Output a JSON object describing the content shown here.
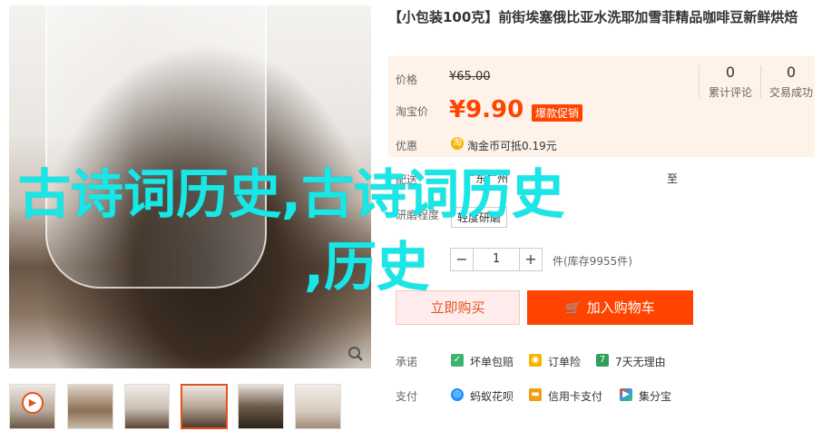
{
  "product": {
    "title": "【小包装100克】前街埃塞俄比亚水洗耶加雪菲精品咖啡豆新鲜烘焙"
  },
  "price": {
    "original_label": "价格",
    "original_value": "¥65.00",
    "promo_label": "淘宝价",
    "promo_value": "¥9.90",
    "promo_badge": "爆款促销"
  },
  "stats": [
    {
      "count": "0",
      "label": "累计评论"
    },
    {
      "count": "0",
      "label": "交易成功"
    }
  ],
  "discount": {
    "label": "优惠",
    "coin_text": "淘",
    "value": "淘金币可抵0.19元"
  },
  "delivery": {
    "label": "配送",
    "from": "广东广州",
    "to": "至"
  },
  "grind": {
    "label": "研磨程度",
    "option": "轻度研磨"
  },
  "quantity": {
    "minus": "−",
    "value": "1",
    "plus": "+",
    "stock": "件(库存9955件)"
  },
  "actions": {
    "buy_now": "立即购买",
    "add_cart": "加入购物车",
    "cart_icon": "🛒"
  },
  "promise": {
    "label": "承诺",
    "items": [
      "坏单包赔",
      "订单险",
      "7天无理由"
    ]
  },
  "payment": {
    "label": "支付",
    "items": [
      "蚂蚁花呗",
      "信用卡支付",
      "集分宝"
    ]
  },
  "watermark": {
    "line1": "古诗词历史,古诗词历史",
    "line2": ",历史"
  },
  "colors": {
    "accent": "#ff4400",
    "overlay": "#19e6e6"
  }
}
